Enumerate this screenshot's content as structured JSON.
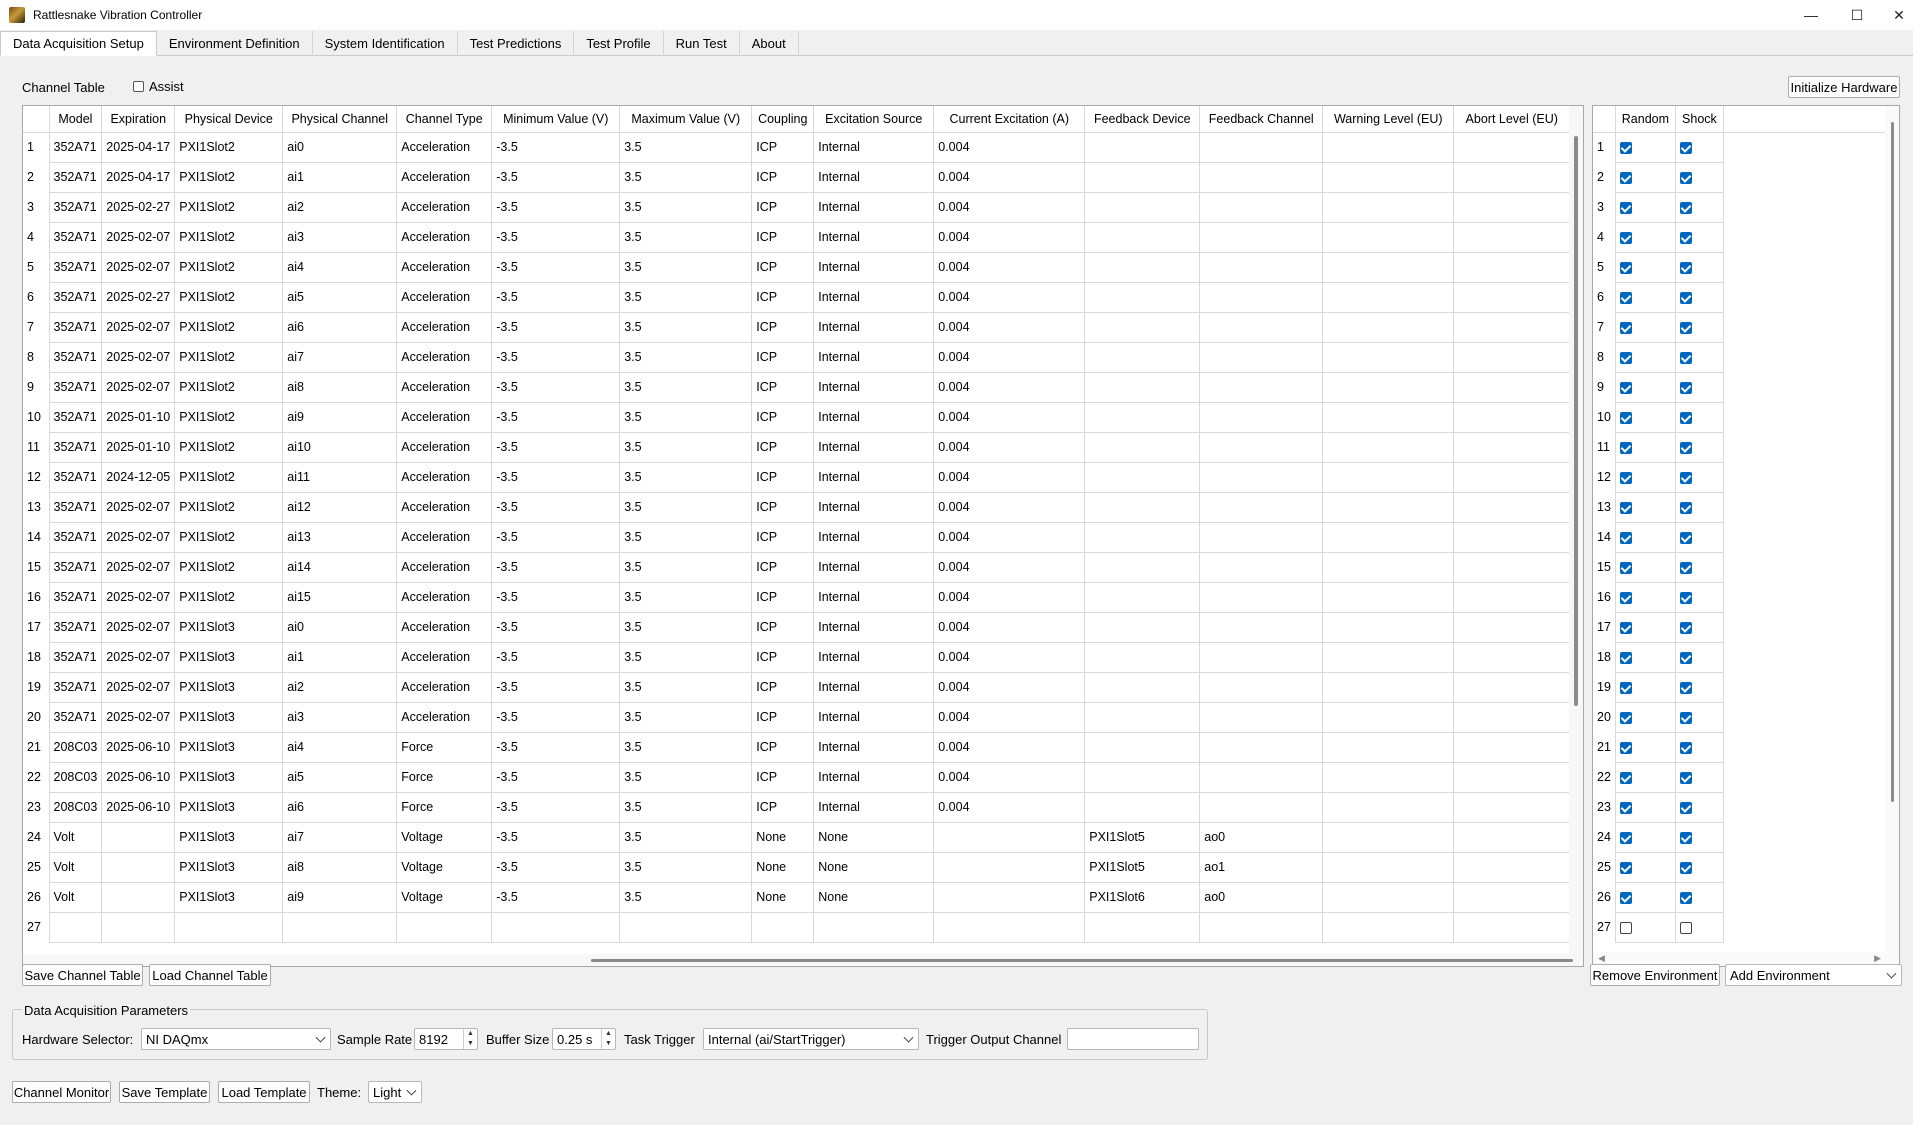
{
  "window": {
    "title": "Rattlesnake Vibration Controller",
    "minimize": "—",
    "maximize": "☐",
    "close": "✕"
  },
  "tabs": [
    "Data Acquisition Setup",
    "Environment Definition",
    "System Identification",
    "Test Predictions",
    "Test Profile",
    "Run Test",
    "About"
  ],
  "channel_table": {
    "label": "Channel Table",
    "assist_label": "Assist",
    "assist_checked": false,
    "init_button": "Initialize Hardware",
    "columns": [
      "Model",
      "Expiration",
      "Physical Device",
      "Physical Channel",
      "Channel Type",
      "Minimum Value (V)",
      "Maximum Value (V)",
      "Coupling",
      "Excitation Source",
      "Current Excitation (A)",
      "Feedback Device",
      "Feedback Channel",
      "Warning Level (EU)",
      "Abort Level (EU)"
    ],
    "rows": [
      [
        "1",
        "352A71",
        "2025-04-17",
        "PXI1Slot2",
        "ai0",
        "Acceleration",
        "-3.5",
        "3.5",
        "ICP",
        "Internal",
        "0.004",
        "",
        "",
        "",
        ""
      ],
      [
        "2",
        "352A71",
        "2025-04-17",
        "PXI1Slot2",
        "ai1",
        "Acceleration",
        "-3.5",
        "3.5",
        "ICP",
        "Internal",
        "0.004",
        "",
        "",
        "",
        ""
      ],
      [
        "3",
        "352A71",
        "2025-02-27",
        "PXI1Slot2",
        "ai2",
        "Acceleration",
        "-3.5",
        "3.5",
        "ICP",
        "Internal",
        "0.004",
        "",
        "",
        "",
        ""
      ],
      [
        "4",
        "352A71",
        "2025-02-07",
        "PXI1Slot2",
        "ai3",
        "Acceleration",
        "-3.5",
        "3.5",
        "ICP",
        "Internal",
        "0.004",
        "",
        "",
        "",
        ""
      ],
      [
        "5",
        "352A71",
        "2025-02-07",
        "PXI1Slot2",
        "ai4",
        "Acceleration",
        "-3.5",
        "3.5",
        "ICP",
        "Internal",
        "0.004",
        "",
        "",
        "",
        ""
      ],
      [
        "6",
        "352A71",
        "2025-02-27",
        "PXI1Slot2",
        "ai5",
        "Acceleration",
        "-3.5",
        "3.5",
        "ICP",
        "Internal",
        "0.004",
        "",
        "",
        "",
        ""
      ],
      [
        "7",
        "352A71",
        "2025-02-07",
        "PXI1Slot2",
        "ai6",
        "Acceleration",
        "-3.5",
        "3.5",
        "ICP",
        "Internal",
        "0.004",
        "",
        "",
        "",
        ""
      ],
      [
        "8",
        "352A71",
        "2025-02-07",
        "PXI1Slot2",
        "ai7",
        "Acceleration",
        "-3.5",
        "3.5",
        "ICP",
        "Internal",
        "0.004",
        "",
        "",
        "",
        ""
      ],
      [
        "9",
        "352A71",
        "2025-02-07",
        "PXI1Slot2",
        "ai8",
        "Acceleration",
        "-3.5",
        "3.5",
        "ICP",
        "Internal",
        "0.004",
        "",
        "",
        "",
        ""
      ],
      [
        "10",
        "352A71",
        "2025-01-10",
        "PXI1Slot2",
        "ai9",
        "Acceleration",
        "-3.5",
        "3.5",
        "ICP",
        "Internal",
        "0.004",
        "",
        "",
        "",
        ""
      ],
      [
        "11",
        "352A71",
        "2025-01-10",
        "PXI1Slot2",
        "ai10",
        "Acceleration",
        "-3.5",
        "3.5",
        "ICP",
        "Internal",
        "0.004",
        "",
        "",
        "",
        ""
      ],
      [
        "12",
        "352A71",
        "2024-12-05",
        "PXI1Slot2",
        "ai11",
        "Acceleration",
        "-3.5",
        "3.5",
        "ICP",
        "Internal",
        "0.004",
        "",
        "",
        "",
        ""
      ],
      [
        "13",
        "352A71",
        "2025-02-07",
        "PXI1Slot2",
        "ai12",
        "Acceleration",
        "-3.5",
        "3.5",
        "ICP",
        "Internal",
        "0.004",
        "",
        "",
        "",
        ""
      ],
      [
        "14",
        "352A71",
        "2025-02-07",
        "PXI1Slot2",
        "ai13",
        "Acceleration",
        "-3.5",
        "3.5",
        "ICP",
        "Internal",
        "0.004",
        "",
        "",
        "",
        ""
      ],
      [
        "15",
        "352A71",
        "2025-02-07",
        "PXI1Slot2",
        "ai14",
        "Acceleration",
        "-3.5",
        "3.5",
        "ICP",
        "Internal",
        "0.004",
        "",
        "",
        "",
        ""
      ],
      [
        "16",
        "352A71",
        "2025-02-07",
        "PXI1Slot2",
        "ai15",
        "Acceleration",
        "-3.5",
        "3.5",
        "ICP",
        "Internal",
        "0.004",
        "",
        "",
        "",
        ""
      ],
      [
        "17",
        "352A71",
        "2025-02-07",
        "PXI1Slot3",
        "ai0",
        "Acceleration",
        "-3.5",
        "3.5",
        "ICP",
        "Internal",
        "0.004",
        "",
        "",
        "",
        ""
      ],
      [
        "18",
        "352A71",
        "2025-02-07",
        "PXI1Slot3",
        "ai1",
        "Acceleration",
        "-3.5",
        "3.5",
        "ICP",
        "Internal",
        "0.004",
        "",
        "",
        "",
        ""
      ],
      [
        "19",
        "352A71",
        "2025-02-07",
        "PXI1Slot3",
        "ai2",
        "Acceleration",
        "-3.5",
        "3.5",
        "ICP",
        "Internal",
        "0.004",
        "",
        "",
        "",
        ""
      ],
      [
        "20",
        "352A71",
        "2025-02-07",
        "PXI1Slot3",
        "ai3",
        "Acceleration",
        "-3.5",
        "3.5",
        "ICP",
        "Internal",
        "0.004",
        "",
        "",
        "",
        ""
      ],
      [
        "21",
        "208C03",
        "2025-06-10",
        "PXI1Slot3",
        "ai4",
        "Force",
        "-3.5",
        "3.5",
        "ICP",
        "Internal",
        "0.004",
        "",
        "",
        "",
        ""
      ],
      [
        "22",
        "208C03",
        "2025-06-10",
        "PXI1Slot3",
        "ai5",
        "Force",
        "-3.5",
        "3.5",
        "ICP",
        "Internal",
        "0.004",
        "",
        "",
        "",
        ""
      ],
      [
        "23",
        "208C03",
        "2025-06-10",
        "PXI1Slot3",
        "ai6",
        "Force",
        "-3.5",
        "3.5",
        "ICP",
        "Internal",
        "0.004",
        "",
        "",
        "",
        ""
      ],
      [
        "24",
        "Volt",
        "",
        "PXI1Slot3",
        "ai7",
        "Voltage",
        "-3.5",
        "3.5",
        "None",
        "None",
        "",
        "PXI1Slot5",
        "ao0",
        "",
        ""
      ],
      [
        "25",
        "Volt",
        "",
        "PXI1Slot3",
        "ai8",
        "Voltage",
        "-3.5",
        "3.5",
        "None",
        "None",
        "",
        "PXI1Slot5",
        "ao1",
        "",
        ""
      ],
      [
        "26",
        "Volt",
        "",
        "PXI1Slot3",
        "ai9",
        "Voltage",
        "-3.5",
        "3.5",
        "None",
        "None",
        "",
        "PXI1Slot6",
        "ao0",
        "",
        ""
      ],
      [
        "27",
        "",
        "",
        "",
        "",
        "",
        "",
        "",
        "",
        "",
        "",
        "",
        "",
        "",
        ""
      ]
    ],
    "save_button": "Save Channel Table",
    "load_button": "Load Channel Table"
  },
  "environment_table": {
    "columns": [
      "Random",
      "Shock"
    ],
    "rows": [
      {
        "n": "1",
        "random": true,
        "shock": true
      },
      {
        "n": "2",
        "random": true,
        "shock": true
      },
      {
        "n": "3",
        "random": true,
        "shock": true
      },
      {
        "n": "4",
        "random": true,
        "shock": true
      },
      {
        "n": "5",
        "random": true,
        "shock": true
      },
      {
        "n": "6",
        "random": true,
        "shock": true
      },
      {
        "n": "7",
        "random": true,
        "shock": true
      },
      {
        "n": "8",
        "random": true,
        "shock": true
      },
      {
        "n": "9",
        "random": true,
        "shock": true
      },
      {
        "n": "10",
        "random": true,
        "shock": true
      },
      {
        "n": "11",
        "random": true,
        "shock": true
      },
      {
        "n": "12",
        "random": true,
        "shock": true
      },
      {
        "n": "13",
        "random": true,
        "shock": true
      },
      {
        "n": "14",
        "random": true,
        "shock": true
      },
      {
        "n": "15",
        "random": true,
        "shock": true
      },
      {
        "n": "16",
        "random": true,
        "shock": true
      },
      {
        "n": "17",
        "random": true,
        "shock": true
      },
      {
        "n": "18",
        "random": true,
        "shock": true
      },
      {
        "n": "19",
        "random": true,
        "shock": true
      },
      {
        "n": "20",
        "random": true,
        "shock": true
      },
      {
        "n": "21",
        "random": true,
        "shock": true
      },
      {
        "n": "22",
        "random": true,
        "shock": true
      },
      {
        "n": "23",
        "random": true,
        "shock": true
      },
      {
        "n": "24",
        "random": true,
        "shock": true
      },
      {
        "n": "25",
        "random": true,
        "shock": true
      },
      {
        "n": "26",
        "random": true,
        "shock": true
      },
      {
        "n": "27",
        "random": false,
        "shock": false
      }
    ],
    "remove_button": "Remove Environment",
    "add_combo": "Add Environment"
  },
  "daq_params": {
    "group_title": "Data Acquisition Parameters",
    "hardware_label": "Hardware Selector:",
    "hardware_value": "NI DAQmx",
    "sample_rate_label": "Sample Rate",
    "sample_rate_value": "8192",
    "buffer_size_label": "Buffer Size",
    "buffer_size_value": "0.25 s",
    "task_trigger_label": "Task Trigger",
    "task_trigger_value": "Internal (ai/StartTrigger)",
    "trigger_output_label": "Trigger Output Channel",
    "trigger_output_value": ""
  },
  "bottom_bar": {
    "channel_monitor": "Channel Monitor",
    "save_template": "Save Template",
    "load_template": "Load Template",
    "theme_label": "Theme:",
    "theme_value": "Light"
  }
}
